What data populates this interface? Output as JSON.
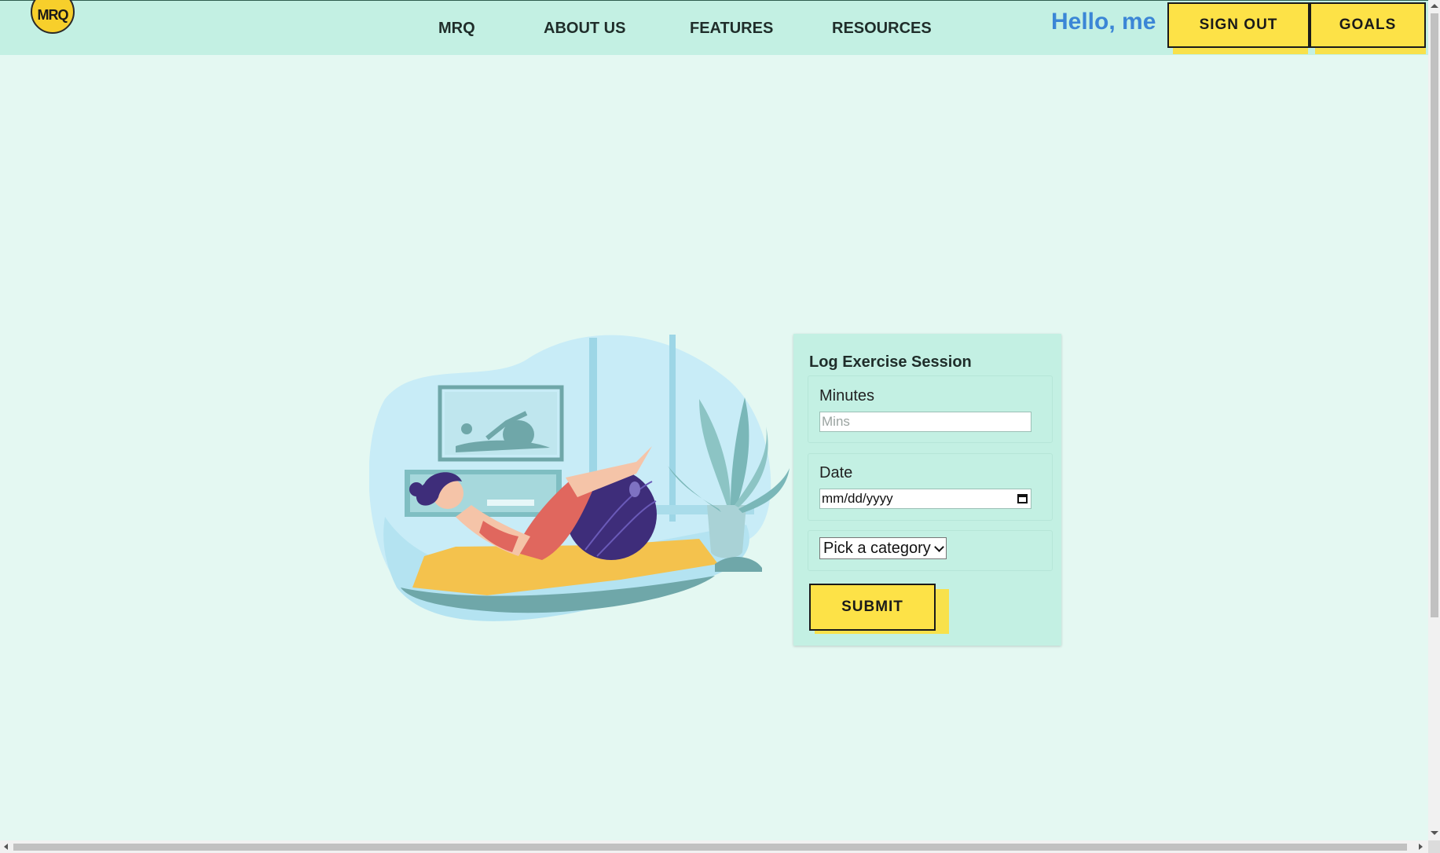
{
  "header": {
    "logo_text": "MRQ",
    "nav": [
      "MRQ",
      "ABOUT US",
      "FEATURES",
      "RESOURCES"
    ],
    "greeting": "Hello, me",
    "sign_out_label": "SIGN OUT",
    "goals_label": "GOALS"
  },
  "form": {
    "title": "Log Exercise Session",
    "minutes_label": "Minutes",
    "minutes_placeholder": "Mins",
    "date_label": "Date",
    "date_value": "mm/dd/yyyy",
    "category_selected": "Pick a category",
    "submit_label": "SUBMIT"
  },
  "colors": {
    "page_bg": "#e4f8f2",
    "header_bg": "#c3f0e3",
    "accent_yellow": "#fde247",
    "greeting_blue": "#3b86d6"
  }
}
